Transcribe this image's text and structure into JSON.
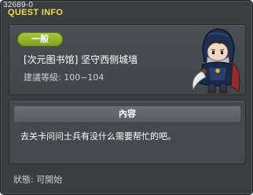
{
  "window": {
    "id": "32689-0",
    "title": "QUEST INFO"
  },
  "quest": {
    "category": "一般",
    "name": "[次元图书馆] 坚守西侧城墙",
    "level_range": "建議等級: 100~104"
  },
  "content": {
    "header": "內容",
    "text": "去关卡问问士兵有没什么需要帮忙的吧。"
  },
  "status": "狀態: 可開始",
  "colors": {
    "title": "#f2dd4e",
    "badge": "#8db42b",
    "window_bg": "#3a3d40"
  },
  "icons": {
    "close": "close-icon",
    "npc": "npc-portrait"
  }
}
